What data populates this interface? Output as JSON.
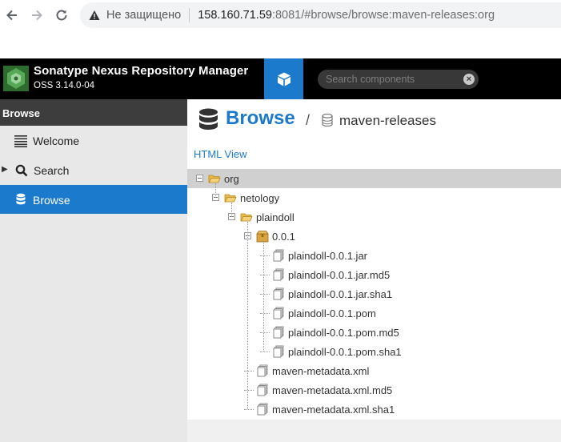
{
  "browser": {
    "insecure_label": "Не защищено",
    "url_host": "158.160.71.59",
    "url_rest": ":8081/#browse/browse:maven-releases:org"
  },
  "app": {
    "title": "Sonatype Nexus Repository Manager",
    "version": "OSS 3.14.0-04",
    "search_placeholder": "Search components"
  },
  "sidebar": {
    "header": "Browse",
    "items": [
      {
        "label": "Welcome",
        "icon": "list-icon"
      },
      {
        "label": "Search",
        "icon": "search-icon"
      },
      {
        "label": "Browse",
        "icon": "database-icon",
        "active": true
      }
    ]
  },
  "main": {
    "breadcrumb_title": "Browse",
    "breadcrumb_separator": "/",
    "repository": "maven-releases",
    "html_view_link": "HTML View"
  },
  "tree": [
    {
      "label": "org",
      "type": "folder-open",
      "level": 0,
      "selected": true
    },
    {
      "label": "netology",
      "type": "folder-open",
      "level": 1
    },
    {
      "label": "plaindoll",
      "type": "folder-open",
      "level": 2
    },
    {
      "label": "0.0.1",
      "type": "package",
      "level": 3
    },
    {
      "label": "plaindoll-0.0.1.jar",
      "type": "file",
      "level": 4
    },
    {
      "label": "plaindoll-0.0.1.jar.md5",
      "type": "file",
      "level": 4
    },
    {
      "label": "plaindoll-0.0.1.jar.sha1",
      "type": "file",
      "level": 4
    },
    {
      "label": "plaindoll-0.0.1.pom",
      "type": "file",
      "level": 4
    },
    {
      "label": "plaindoll-0.0.1.pom.md5",
      "type": "file",
      "level": 4
    },
    {
      "label": "plaindoll-0.0.1.pom.sha1",
      "type": "file",
      "level": 4
    },
    {
      "label": "maven-metadata.xml",
      "type": "file",
      "level": 3
    },
    {
      "label": "maven-metadata.xml.md5",
      "type": "file",
      "level": 3
    },
    {
      "label": "maven-metadata.xml.sha1",
      "type": "file",
      "level": 3
    }
  ],
  "colors": {
    "accent": "#1b7acc",
    "header_bg": "#000000",
    "sidebar_bg": "#e8e8e8"
  }
}
